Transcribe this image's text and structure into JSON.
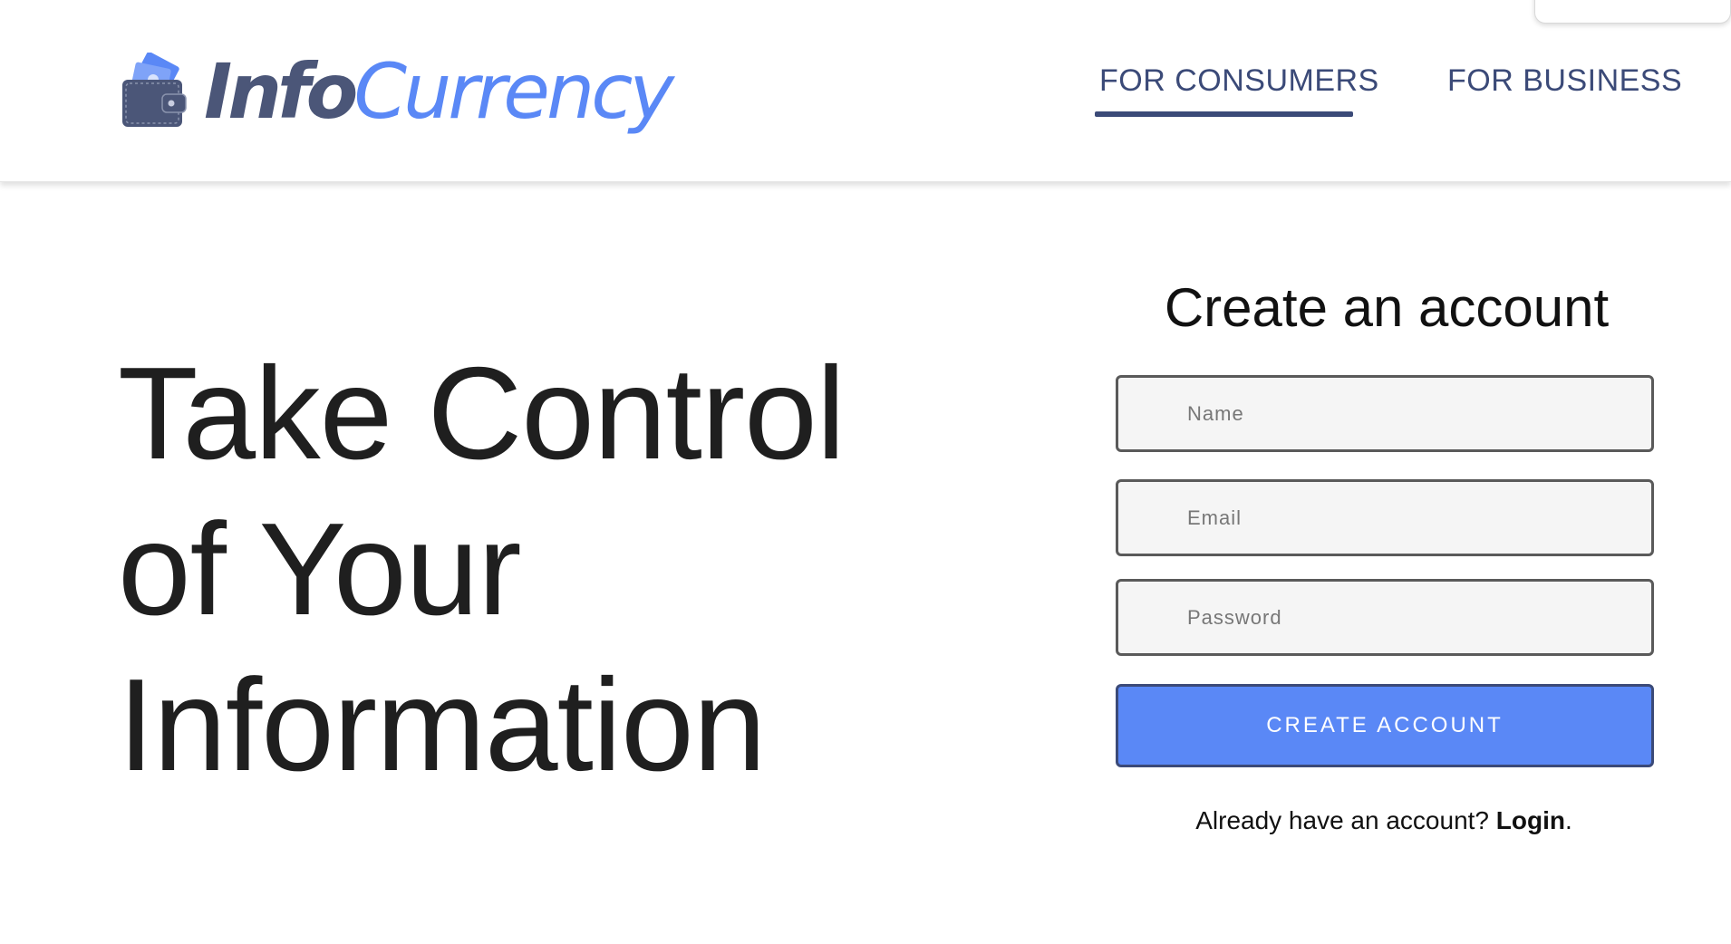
{
  "header": {
    "logo": {
      "part1": "Info",
      "part2": "Currency",
      "icon": "wallet-icon"
    },
    "nav": [
      {
        "label": "FOR CONSUMERS",
        "active": true
      },
      {
        "label": "FOR BUSINESS",
        "active": false
      }
    ]
  },
  "hero": {
    "line1": "Take Control",
    "line2": "of Your",
    "line3": "Information"
  },
  "form": {
    "title": "Create an account",
    "name_placeholder": "Name",
    "email_placeholder": "Email",
    "password_placeholder": "Password",
    "submit_label": "CREATE ACCOUNT",
    "login_prompt": "Already have an account? ",
    "login_link": "Login",
    "login_suffix": "."
  },
  "colors": {
    "accent": "#5a88f6",
    "navy": "#3b4a78",
    "text": "#1f1f1f"
  }
}
